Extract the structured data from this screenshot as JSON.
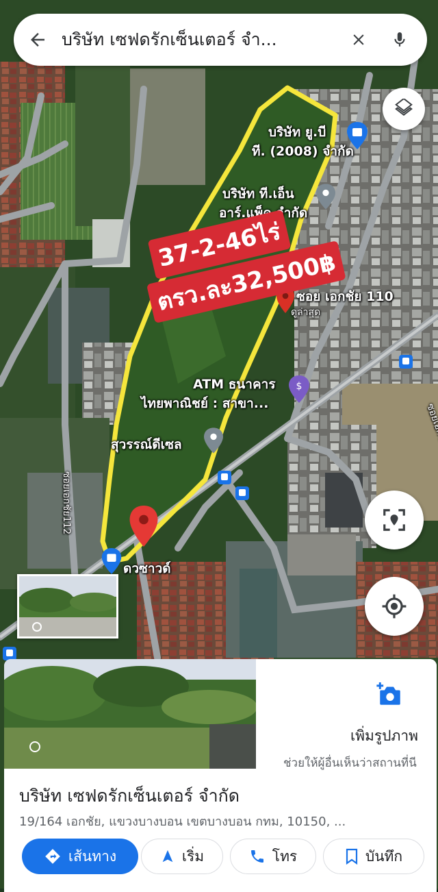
{
  "search": {
    "query": "บริษัท เซฟดรักเซ็นเตอร์ จำ..."
  },
  "map": {
    "labels": {
      "ub": "บริษัท ยู.บี",
      "ub2": "ที. (2008) จำกัด",
      "tnr": "บริษัท ที.เอ็น",
      "tnr2": "อาร์.แพ็ค จำกัด",
      "soi110": "ซอย เอกชัย 110",
      "latest": "ดูล่าสุด",
      "atm": "ATM ธนาคาร",
      "atm2": "ไทยพาณิชย์ : สาขา...",
      "suwan": "สุวรรณ์ดีเซล",
      "soi112": "ซอยเอกชัย112",
      "dusit": "ดวซาวด์",
      "soiR": "ซอยเอกชัย10"
    }
  },
  "listing": {
    "size": "37-2-46ไร่",
    "price": "ตรว.ละ32,500฿"
  },
  "place": {
    "add_photo_label": "เพิ่มรูปภาพ",
    "add_photo_help": "ช่วยให้ผู้อื่นเห็นว่าสถานที่นี",
    "name": "บริษัท เซฟดรักเซ็นเตอร์ จำกัด",
    "address": "19/164 เอกชัย, แขวงบางบอน เขตบางบอน กทม, 10150, ..."
  },
  "actions": {
    "directions": "เส้นทาง",
    "start": "เริ่ม",
    "call": "โทร",
    "save": "บันทึก"
  },
  "colors": {
    "accent": "#1a73e8",
    "boundary": "#f5e63c",
    "banner": "#d62b34",
    "pin": "#e53935"
  }
}
